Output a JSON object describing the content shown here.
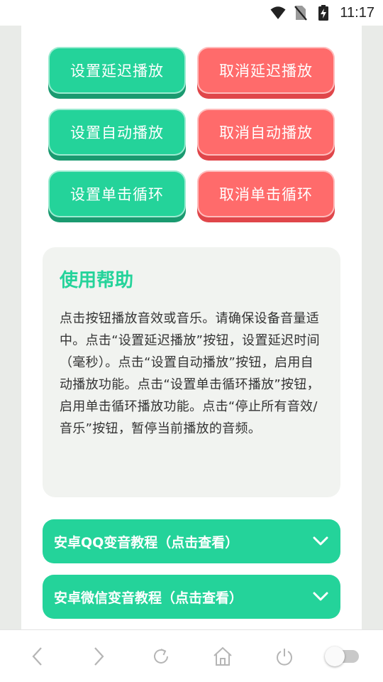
{
  "status_bar": {
    "time": "11:17",
    "icons": [
      "wifi-icon",
      "no-sim-icon",
      "battery-charging-icon"
    ]
  },
  "buttons": {
    "set_delay": "设置延迟播放",
    "cancel_delay": "取消延迟播放",
    "set_auto": "设置自动播放",
    "cancel_auto": "取消自动播放",
    "set_loop": "设置单击循环",
    "cancel_loop": "取消单击循环"
  },
  "help": {
    "title": "使用帮助",
    "body": "点击按钮播放音效或音乐。请确保设备音量适中。点击“设置延迟播放”按钮，设置延迟时间（毫秒）。点击“设置自动播放”按钮，启用自动播放功能。点击“设置单击循环播放”按钮，启用单击循环播放功能。点击“停止所有音效/音乐”按钮，暂停当前播放的音频。"
  },
  "accordions": {
    "qq": "安卓QQ变音教程（点击查看）",
    "wechat": "安卓微信变音教程（点击查看）"
  },
  "colors": {
    "green": "#24d39a",
    "green_shadow": "#1a9a70",
    "red": "#ff6b6b",
    "red_shadow": "#e0464a"
  },
  "navbar": {
    "icons": [
      "back-icon",
      "forward-icon",
      "refresh-icon",
      "home-icon",
      "power-icon",
      "toggle-switch"
    ]
  }
}
